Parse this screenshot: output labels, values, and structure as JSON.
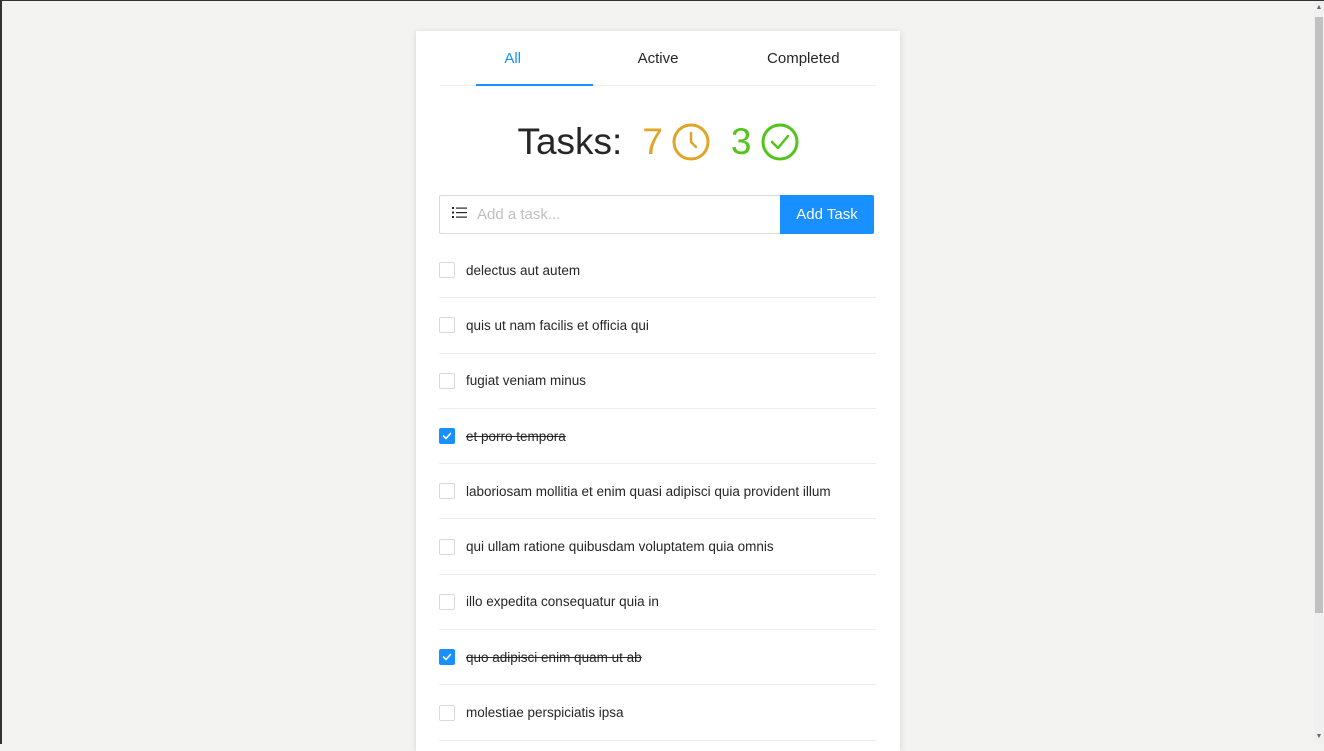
{
  "tabs": [
    {
      "label": "All",
      "active": true
    },
    {
      "label": "Active",
      "active": false
    },
    {
      "label": "Completed",
      "active": false
    }
  ],
  "stats": {
    "title": "Tasks:",
    "active_count": "7",
    "completed_count": "3",
    "active_icon": "clock-icon",
    "completed_icon": "check-circle-icon"
  },
  "add_task": {
    "placeholder": "Add a task...",
    "value": "",
    "button_label": "Add Task",
    "icon": "list-icon"
  },
  "tasks": [
    {
      "text": "delectus aut autem",
      "done": false
    },
    {
      "text": "quis ut nam facilis et officia qui",
      "done": false
    },
    {
      "text": "fugiat veniam minus",
      "done": false
    },
    {
      "text": "et porro tempora",
      "done": true
    },
    {
      "text": "laboriosam mollitia et enim quasi adipisci quia provident illum",
      "done": false
    },
    {
      "text": "qui ullam ratione quibusdam voluptatem quia omnis",
      "done": false
    },
    {
      "text": "illo expedita consequatur quia in",
      "done": false
    },
    {
      "text": "quo adipisci enim quam ut ab",
      "done": true
    },
    {
      "text": "molestiae perspiciatis ipsa",
      "done": false
    }
  ],
  "colors": {
    "accent": "#1890ff",
    "active_stat": "#e0a528",
    "completed_stat": "#52c41a",
    "background": "#f3f3f1"
  }
}
